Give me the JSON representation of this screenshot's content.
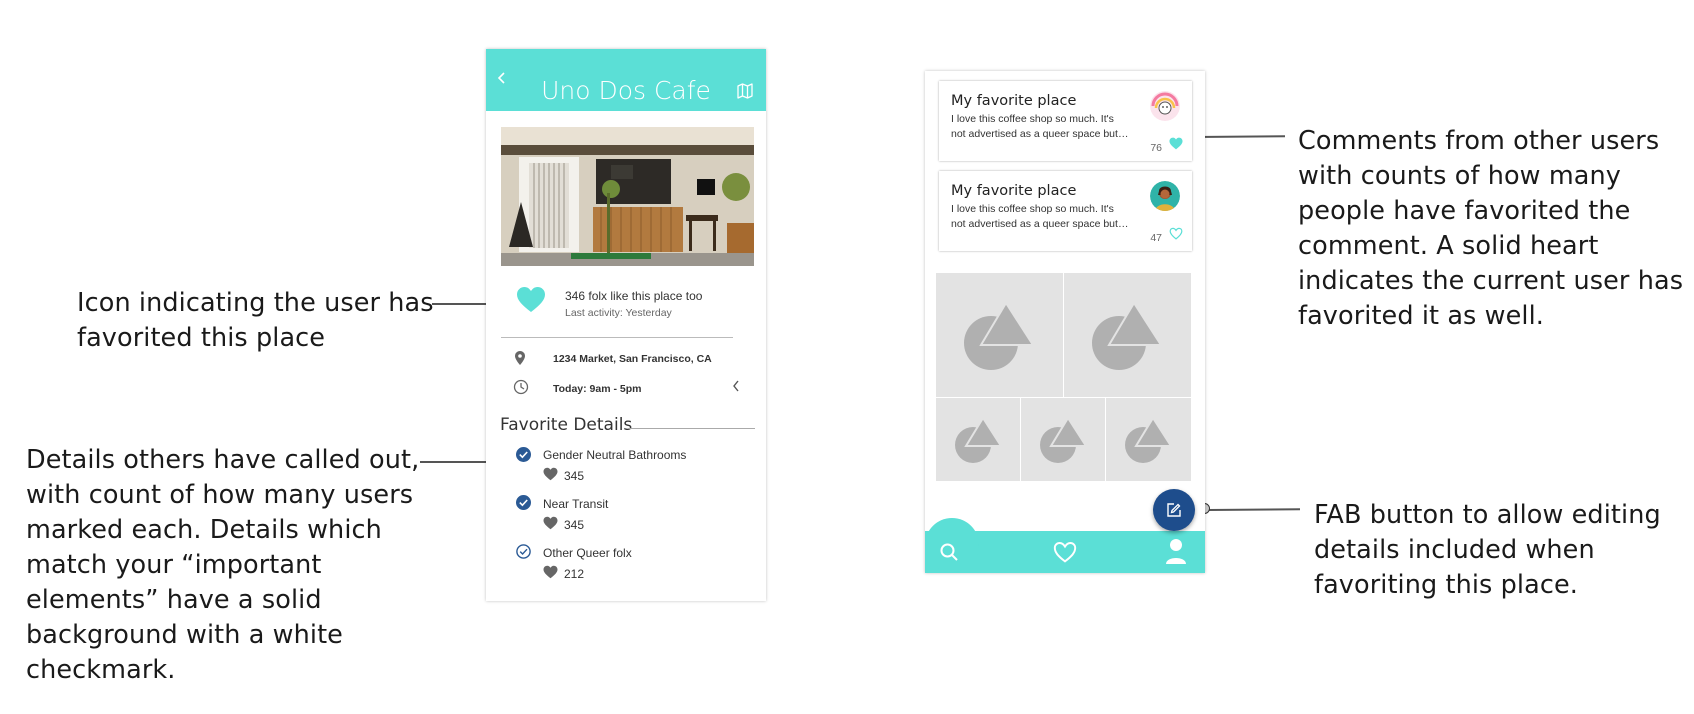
{
  "annotations": {
    "favorite_icon": [
      "Icon indicating the user has",
      "favorited this place"
    ],
    "details": [
      "Details others have called out,",
      "with count of how many users",
      "marked each. Details which",
      "match your “important",
      "elements” have a solid",
      "background with a white",
      "checkmark."
    ],
    "comments": [
      "Comments from other users",
      "with counts of how many",
      "people have favorited the",
      "comment. A solid heart",
      "indicates the current user has",
      "favorited it as well."
    ],
    "fab": [
      "FAB button to allow editing",
      "details included when",
      "favoriting this place."
    ]
  },
  "place_screen": {
    "title": "Uno Dos Cafe",
    "back_icon": "chevron-left-icon",
    "map_icon": "map-icon",
    "likes_text": "346 folx like this place too",
    "last_activity": "Last activity: Yesterday",
    "address": "1234 Market, San Francisco, CA",
    "hours": "Today: 9am - 5pm",
    "section_title": "Favorite Details",
    "details": [
      {
        "label": "Gender Neutral Bathrooms",
        "count": "345",
        "important": true
      },
      {
        "label": "Near Transit",
        "count": "345",
        "important": true
      },
      {
        "label": "Other Queer folx",
        "count": "212",
        "important": false
      }
    ]
  },
  "comments_screen": {
    "comments": [
      {
        "title": "My favorite place",
        "body": "I love this coffee shop so much. It's not advertised as a queer space but…",
        "count": "76",
        "favorited": true
      },
      {
        "title": "My favorite place",
        "body": "I love this coffee shop so much. It's not advertised as a queer space but…",
        "count": "47",
        "favorited": false
      }
    ],
    "nav_icons": [
      "search-icon",
      "heart-icon",
      "profile-icon"
    ],
    "fab_icon": "edit-icon"
  },
  "colors": {
    "accent": "#5bdfd6",
    "fab": "#1e4d8c",
    "check": "#2b5a95",
    "placeholder": "#e3e3e3"
  }
}
